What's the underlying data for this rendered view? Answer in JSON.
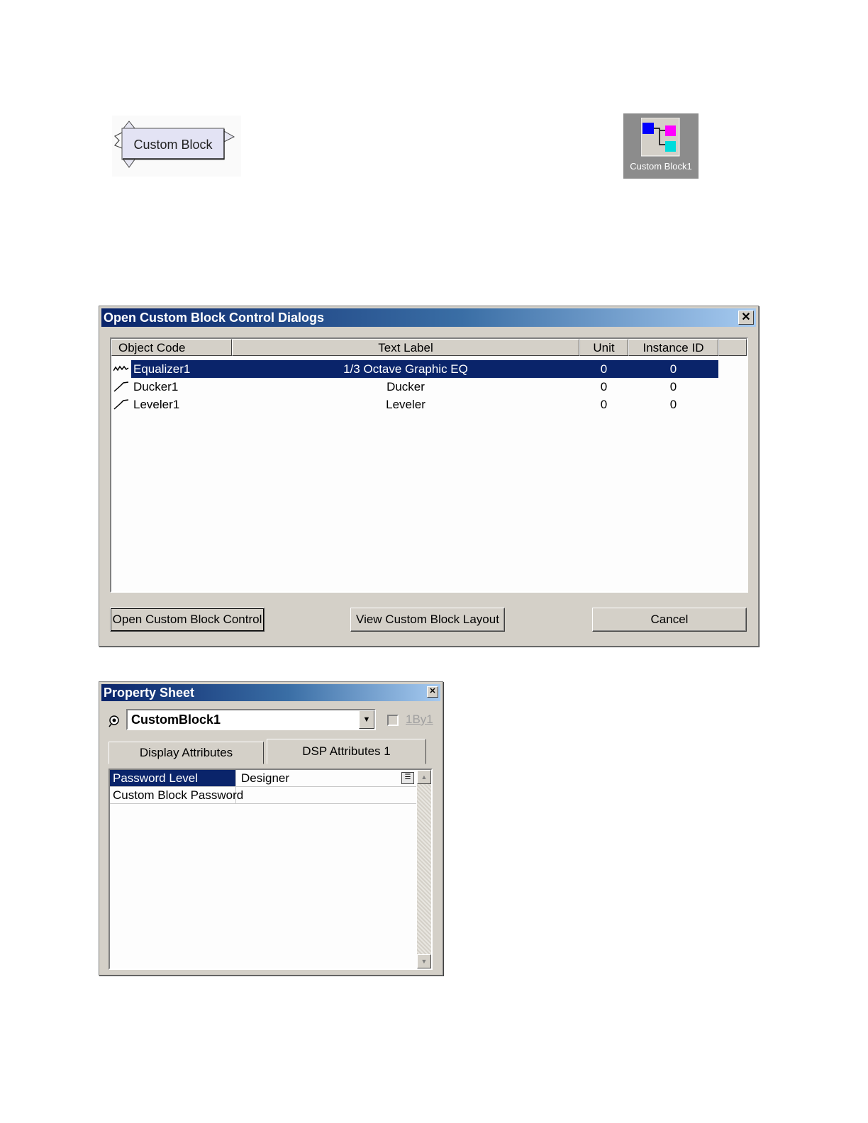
{
  "custom_block_node": {
    "label": "Custom Block"
  },
  "icon_tile": {
    "label": "Custom Block1",
    "icon": "custom-block-icon"
  },
  "dialog": {
    "title": "Open Custom Block Control Dialogs",
    "columns": [
      "Object Code",
      "Text Label",
      "Unit",
      "Instance ID"
    ],
    "rows": [
      {
        "icon": "eq-wave-icon",
        "object_code": "Equalizer1",
        "text_label": "1/3 Octave Graphic EQ",
        "unit": "0",
        "instance_id": "0",
        "selected": true
      },
      {
        "icon": "dynamics-curve-icon",
        "object_code": "Ducker1",
        "text_label": "Ducker",
        "unit": "0",
        "instance_id": "0",
        "selected": false
      },
      {
        "icon": "dynamics-curve-icon",
        "object_code": "Leveler1",
        "text_label": "Leveler",
        "unit": "0",
        "instance_id": "0",
        "selected": false
      }
    ],
    "buttons": {
      "open": "Open Custom Block Control",
      "view": "View Custom Block Layout",
      "cancel": "Cancel"
    }
  },
  "property_sheet": {
    "title": "Property Sheet",
    "selector_value": "CustomBlock1",
    "checkbox_label": "1By1",
    "tabs": [
      "Display Attributes",
      "DSP Attributes 1"
    ],
    "properties": [
      {
        "name": "Password Level",
        "value": "Designer"
      },
      {
        "name": "Custom Block Password",
        "value": ""
      }
    ]
  },
  "colors": {
    "titlebar": "#0a246a",
    "selection": "#0a246a",
    "face": "#d4d0c8"
  }
}
